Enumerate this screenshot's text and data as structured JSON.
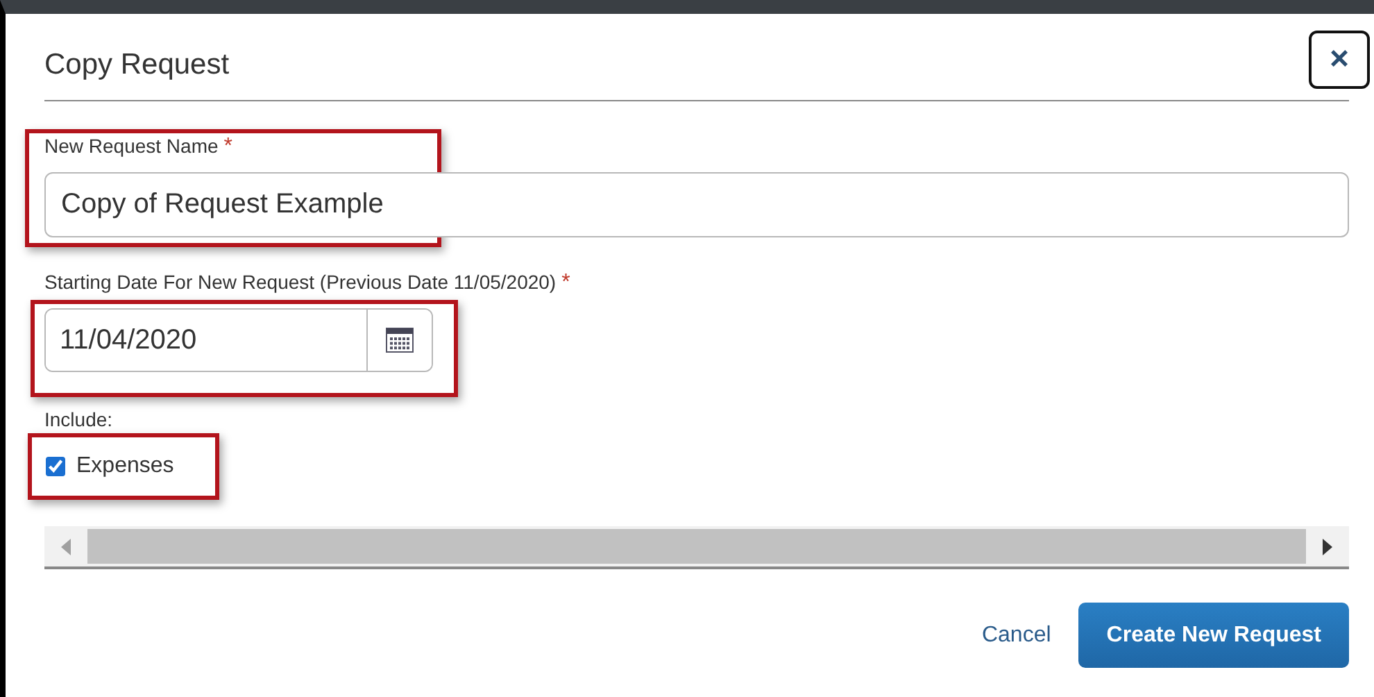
{
  "dialog": {
    "title": "Copy Request",
    "close": "×"
  },
  "fields": [
    {
      "kind": "text",
      "label": "New Request Name",
      "required_mark": "*",
      "value": "Copy of Request Example",
      "highlighted": true
    },
    {
      "kind": "date",
      "label": "Starting Date For New Request (Previous Date 11/05/2020)",
      "required_mark": "*",
      "value": "11/04/2020",
      "highlighted": true
    }
  ],
  "include": {
    "label": "Include:",
    "options": [
      {
        "label": "Expenses",
        "checked": true,
        "highlighted": true
      }
    ]
  },
  "buttons": [
    {
      "kind": "link",
      "label": "Cancel"
    },
    {
      "kind": "primary",
      "label": "Create New Request"
    }
  ]
}
